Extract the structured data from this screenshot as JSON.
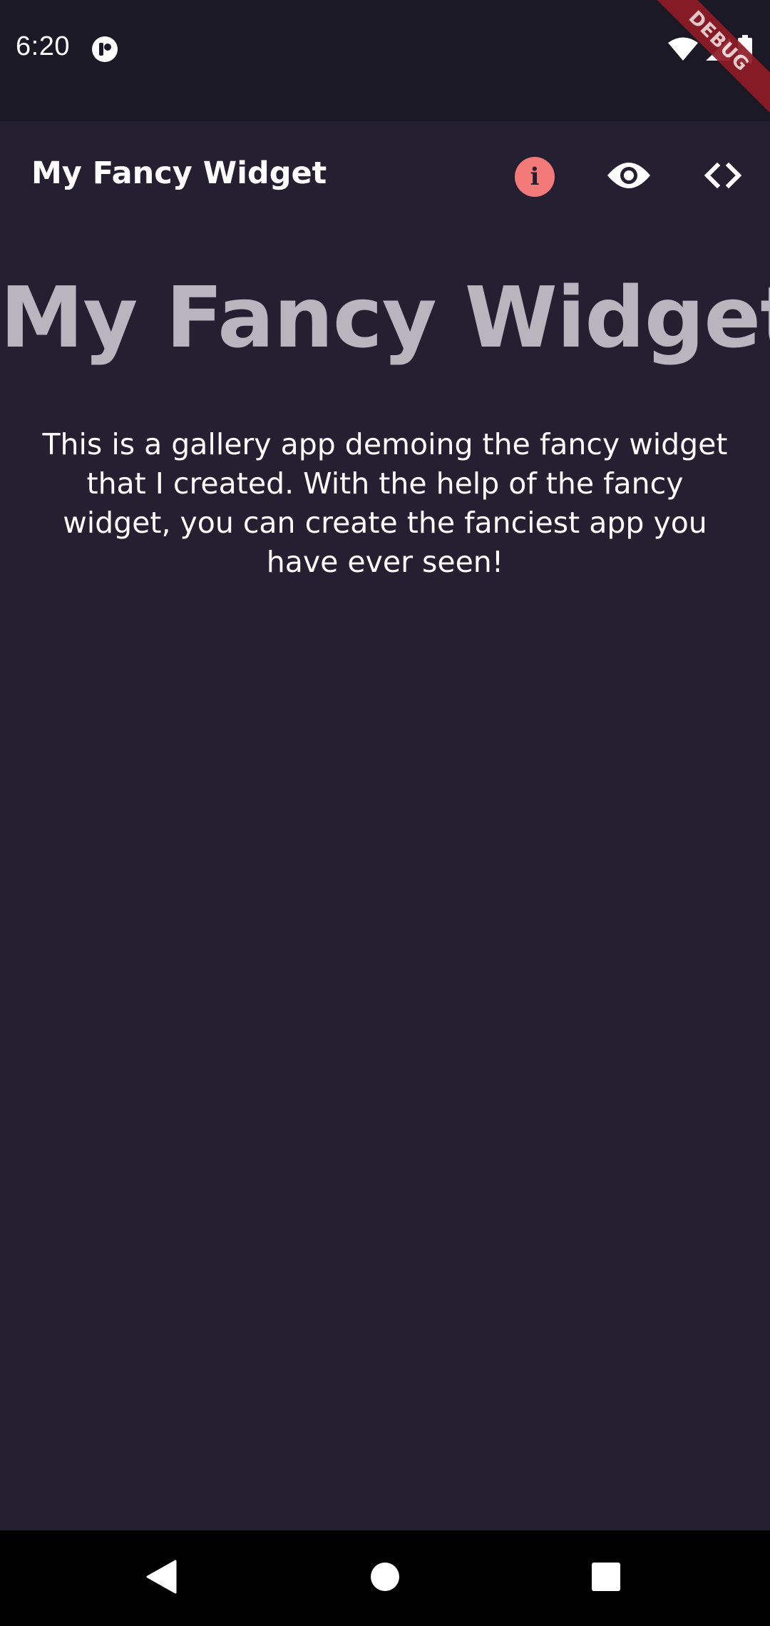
{
  "status_bar": {
    "time": "6:20",
    "icons": [
      "app-notification-icon",
      "wifi-icon",
      "cell-signal-icon",
      "battery-icon"
    ],
    "debug_banner": "DEBUG"
  },
  "app_bar": {
    "title": "My Fancy Widget",
    "actions": [
      {
        "icon": "info-icon",
        "label": "i",
        "color": "#f47a7a"
      },
      {
        "icon": "eye-icon"
      },
      {
        "icon": "code-icon"
      }
    ]
  },
  "content": {
    "headline": "My Fancy Widget",
    "description": "This is a gallery app demoing the fancy widget that I created. With the help of the fancy widget, you can create the fanciest app you have ever seen!"
  },
  "nav_bar": {
    "buttons": [
      "back-icon",
      "home-icon",
      "recents-icon"
    ]
  },
  "colors": {
    "background": "#241f31",
    "status_bar": "#1c1926",
    "headline": "#b9b5be",
    "accent_info": "#f47a7a",
    "debug_ribbon": "#8f1b25",
    "nav_bar": "#000000"
  }
}
